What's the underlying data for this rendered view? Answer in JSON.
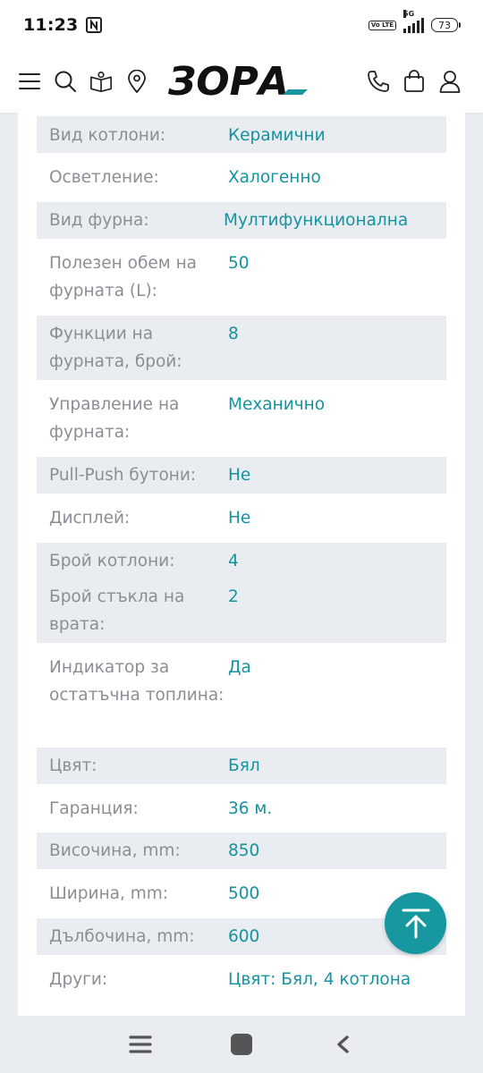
{
  "status_bar": {
    "time": "11:23",
    "network": "5G",
    "volte": "Vo LTE",
    "battery": "73"
  },
  "header": {
    "logo": "ЗОРА",
    "icons": [
      "menu-icon",
      "search-icon",
      "catalog-icon",
      "location-icon",
      "phone-icon",
      "cart-icon",
      "user-icon"
    ]
  },
  "specs": [
    {
      "key": "Вид котлони:",
      "value": "Керамични"
    },
    {
      "key": "Осветление:",
      "value": "Халогенно"
    },
    {
      "key": "Вид фурна:",
      "value": "Мултифункционална"
    },
    {
      "key": "Полезен обем на фурната (L):",
      "value": "50"
    },
    {
      "key": "Функции на фурната, брой:",
      "value": "8"
    },
    {
      "key": "Управление на фурната:",
      "value": "Механично"
    },
    {
      "key": "Pull-Push бутони:",
      "value": "Не"
    },
    {
      "key": "Дисплей:",
      "value": "Не"
    },
    {
      "key": "Брой котлони:",
      "value": "4"
    },
    {
      "key": "Брой стъкла на врата:",
      "value": "2"
    },
    {
      "key": "Индикатор за остатъчна топлина:",
      "value": "Да"
    },
    {
      "key": "Цвят:",
      "value": "Бял"
    },
    {
      "key": "Гаранция:",
      "value": "36 м."
    },
    {
      "key": "Височина, mm:",
      "value": "850"
    },
    {
      "key": "Ширина, mm:",
      "value": "500"
    },
    {
      "key": "Дълбочина, mm:",
      "value": "600"
    },
    {
      "key": "Други:",
      "value": "Цвят: Бял, 4 котлона"
    }
  ],
  "colors": {
    "accent": "#15939e",
    "label": "#8a8f94",
    "stripe": "#e9edf1"
  }
}
